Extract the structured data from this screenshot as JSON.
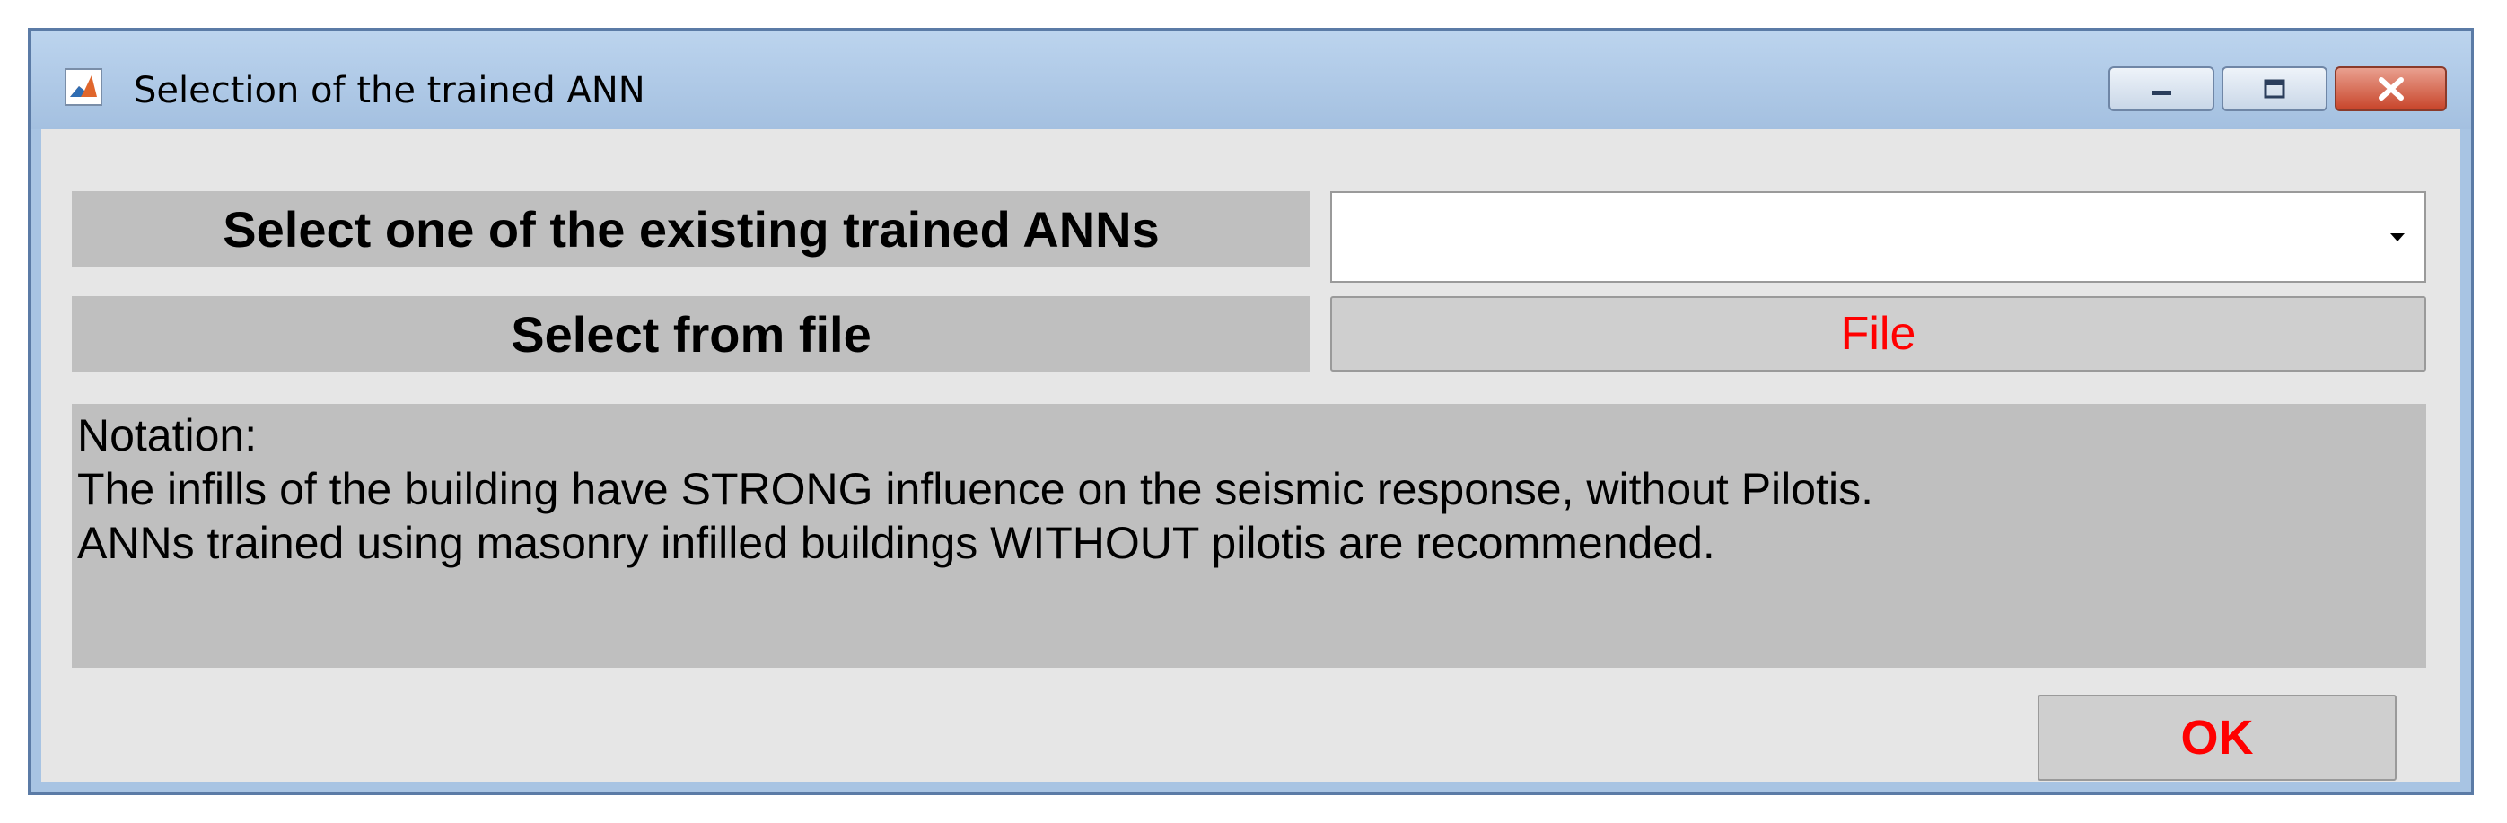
{
  "window": {
    "title": "Selection of the trained ANN",
    "icon": "matlab-icon",
    "controls": {
      "minimize": "minimize-icon",
      "maximize": "maximize-icon",
      "close": "close-icon"
    }
  },
  "form": {
    "existing_label": "Select one of the existing trained ANNs",
    "existing_dropdown_value": "",
    "file_label": "Select from file",
    "file_button": "File"
  },
  "notation": {
    "heading": "Notation:",
    "line1": "The infills of the building have STRONG influence on the seismic response, without Pilotis.",
    "line2": "ANNs trained using masonry infilled buildings WITHOUT pilotis are recommended."
  },
  "ok_button": "OK",
  "colors": {
    "accent_text": "#ff0000",
    "panel_gray": "#bfbfbf",
    "client_bg": "#e6e6e6",
    "titlebar": "#a8c4e3"
  }
}
